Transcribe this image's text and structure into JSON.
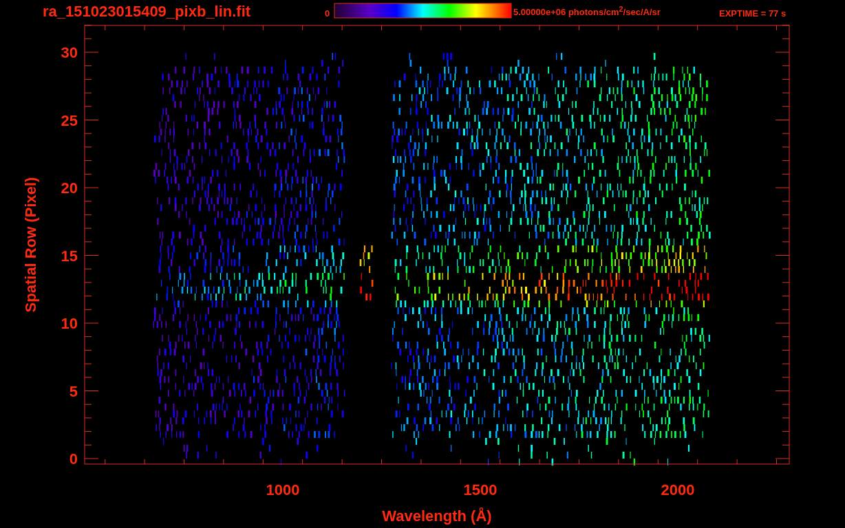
{
  "title": "ra_151023015409_pixb_lin.fit",
  "colorbar": {
    "min_label": "0",
    "max_label": "5.00000e+06 photons/cm$^{2}$/sec/A/sr"
  },
  "exposure": "EXPTIME = 77 s",
  "plot": {
    "xlabel": "Wavelength (Å)",
    "ylabel": "Spatial Row (Pixel)",
    "xticks": [
      "1000",
      "1500",
      "2000"
    ],
    "yticks": [
      "30",
      "25",
      "20",
      "15",
      "10",
      "5",
      "0"
    ]
  }
}
